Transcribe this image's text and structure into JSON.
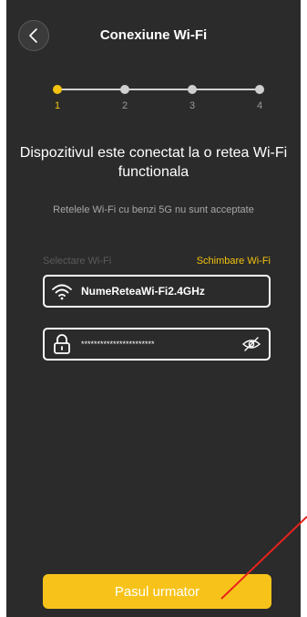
{
  "header": {
    "title": "Conexiune Wi-Fi",
    "back_icon": "chevron-left-icon"
  },
  "stepper": {
    "current": 1,
    "steps": [
      "1",
      "2",
      "3",
      "4"
    ]
  },
  "main": {
    "heading": "Dispozitivul este conectat la o retea Wi-Fi functionala",
    "note": "Retelele Wi-Fi cu benzi 5G nu sunt acceptate"
  },
  "wifi": {
    "select_label": "Selectare Wi-Fi",
    "change_link": "Schimbare Wi-Fi",
    "ssid": "NumeReteaWi-Fi2.4GHz",
    "ssid_icon": "wifi-icon",
    "password_masked": "***********************",
    "password_icon": "lock-icon",
    "visibility_icon": "eye-off-icon"
  },
  "footer": {
    "next_label": "Pasul urmator"
  },
  "colors": {
    "background": "#2b2b2b",
    "accent": "#f2c20f",
    "button": "#f7c31a",
    "annotation_arrow": "#e8231c"
  }
}
